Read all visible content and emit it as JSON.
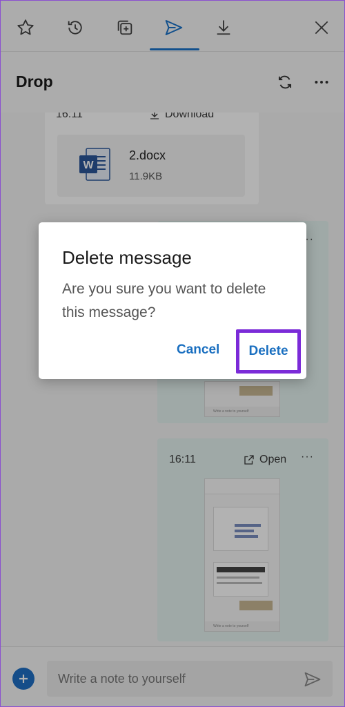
{
  "toolbar": {
    "icons": [
      "star-icon",
      "history-icon",
      "collections-icon",
      "send-icon",
      "download-icon",
      "close-icon"
    ],
    "active_color": "#1a73c9"
  },
  "header": {
    "title": "Drop"
  },
  "messages": [
    {
      "time": "16:11",
      "action": "Download",
      "file_name": "2.docx",
      "file_size": "11.9KB",
      "more": "···"
    },
    {
      "time": "",
      "action": "",
      "more": "···"
    },
    {
      "time": "16:11",
      "action": "Open",
      "more": "···"
    }
  ],
  "thumb_placeholder": "Write a note to yourself",
  "bottom": {
    "placeholder": "Write a note to yourself"
  },
  "dialog": {
    "title": "Delete message",
    "body": "Are you sure you want to delete this message?",
    "cancel": "Cancel",
    "delete": "Delete",
    "highlight_color": "#7b2bd8"
  }
}
